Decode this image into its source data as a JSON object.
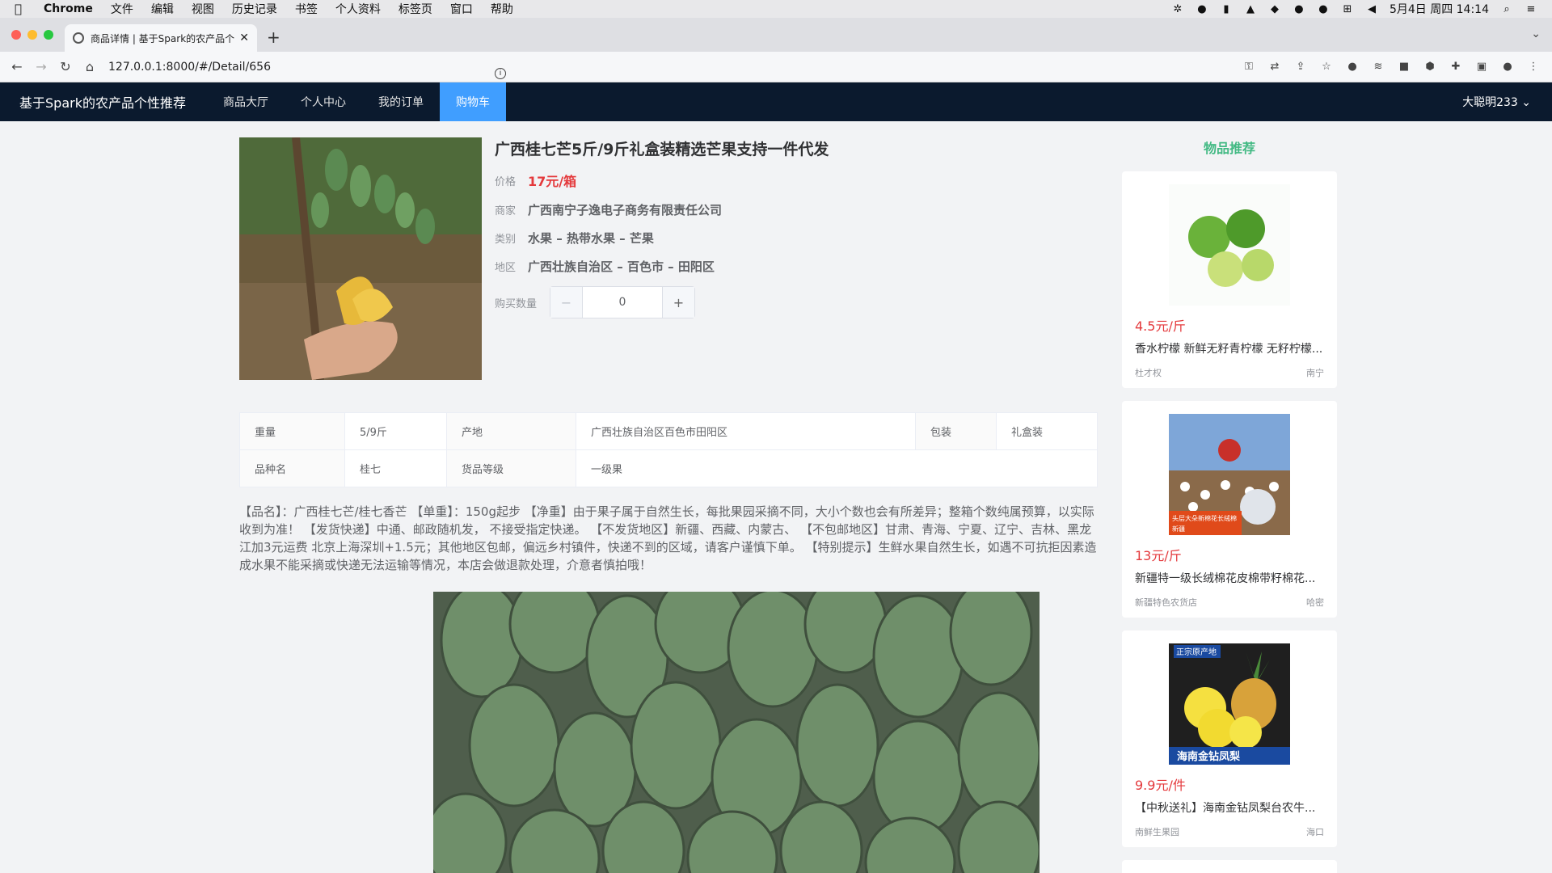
{
  "menubar": {
    "app": "Chrome",
    "items": [
      "文件",
      "编辑",
      "视图",
      "历史记录",
      "书签",
      "个人资料",
      "标签页",
      "窗口",
      "帮助"
    ],
    "clock": "5月4日 周四  14:14"
  },
  "browser": {
    "tab_title": "商品详情 | 基于Spark的农产品个",
    "url": "127.0.0.1:8000/#/Detail/656"
  },
  "navbar": {
    "brand": "基于Spark的农产品个性推荐",
    "items": [
      "商品大厅",
      "个人中心",
      "我的订单",
      "购物车"
    ],
    "active": "购物车",
    "user": "大聪明233"
  },
  "product": {
    "title": "广西桂七芒5斤/9斤礼盒装精选芒果支持一件代发",
    "price_label": "价格",
    "price": "17元/箱",
    "merchant_label": "商家",
    "merchant": "广西南宁子逸电子商务有限责任公司",
    "category_label": "类别",
    "category": "水果 – 热带水果 – 芒果",
    "region_label": "地区",
    "region": "广西壮族自治区 – 百色市 – 田阳区",
    "qty_label": "购买数量",
    "qty": "0"
  },
  "specs": {
    "r1": [
      "重量",
      "5/9斤",
      "产地",
      "广西壮族自治区百色市田阳区",
      "包装",
      "礼盒装"
    ],
    "r2": [
      "品种名",
      "桂七",
      "货品等级",
      "一级果"
    ]
  },
  "description": "【品名】：广西桂七芒/桂七香芒 【单重】：150g起步 【净重】由于果子属于自然生长，每批果园采摘不同，大小个数也会有所差异；整箱个数纯属预算，以实际收到为准！ 【发货快递】中通、邮政随机发， 不接受指定快递。 【不发货地区】新疆、西藏、内蒙古、 【不包邮地区】甘肃、青海、宁夏、辽宁、吉林、黑龙江加3元运费 北京上海深圳+1.5元；其他地区包邮，偏远乡村镇件，快递不到的区域，请客户谨慎下单。 【特别提示】生鲜水果自然生长，如遇不可抗拒因素造成水果不能采摘或快递无法运输等情况，本店会做退款处理，介意者慎拍哦！",
  "sidebar": {
    "title": "物品推荐",
    "items": [
      {
        "price": "4.5元/斤",
        "name": "香水柠檬 新鲜无籽青柠檬 无籽柠檬...",
        "shop": "杜才权",
        "city": "南宁"
      },
      {
        "price": "13元/斤",
        "name": "新疆特一级长绒棉花皮棉带籽棉花...",
        "shop": "新疆特色农货店",
        "city": "哈密",
        "img_text_1": "头层大朵新棉花长绒棉",
        "img_text_2": "新疆"
      },
      {
        "price": "9.9元/件",
        "name": "【中秋送礼】海南金钻凤梨台农牛...",
        "shop": "南鲜生果园",
        "city": "海口",
        "img_text_1": "正宗原产地",
        "img_text_2": "海南金钻凤梨"
      }
    ]
  }
}
